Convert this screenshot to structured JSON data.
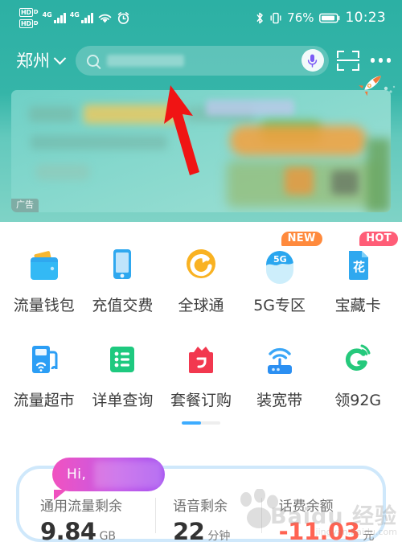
{
  "statusbar": {
    "hd_badges": [
      {
        "box": "HD",
        "sub": "D"
      },
      {
        "box": "HD",
        "sub": "D"
      }
    ],
    "network_labels": [
      "4G",
      "4G"
    ],
    "wifi_icon": "wifi-icon",
    "alarm_icon": "alarm-clock-icon",
    "bluetooth_icon": "bluetooth-icon",
    "vibrate_icon": "vibrate-icon",
    "battery_percent": "76%",
    "battery_icon": "battery-charging-icon",
    "time": "10:23"
  },
  "header": {
    "city": "郑州",
    "city_chevron_icon": "chevron-down-icon",
    "search": {
      "icon": "search-icon",
      "value": "",
      "placeholder": "",
      "mic_icon": "microphone-icon"
    },
    "scan_icon": "scan-qr-icon",
    "more_icon": "more-options-icon"
  },
  "banner": {
    "ad_label": "广告",
    "rocket_icon": "rocket-icon"
  },
  "annotation": {
    "arrow_icon": "red-arrow-up-icon",
    "arrow_color": "#f01414"
  },
  "grid": {
    "rows": [
      [
        {
          "label": "流量钱包",
          "icon": "wallet-icon",
          "badge": null
        },
        {
          "label": "充值交费",
          "icon": "mobile-phone-icon",
          "badge": null
        },
        {
          "label": "全球通",
          "icon": "globe-arrow-icon",
          "badge": null
        },
        {
          "label": "5G专区",
          "icon": "5g-zone-icon",
          "badge": "NEW"
        },
        {
          "label": "宝藏卡",
          "icon": "treasure-card-icon",
          "badge": "HOT"
        }
      ],
      [
        {
          "label": "流量超市",
          "icon": "data-pump-icon",
          "badge": null
        },
        {
          "label": "详单查询",
          "icon": "bill-list-icon",
          "badge": null
        },
        {
          "label": "套餐订购",
          "icon": "package-bag-icon",
          "badge": null
        },
        {
          "label": "装宽带",
          "icon": "router-icon",
          "badge": null
        },
        {
          "label": "领92G",
          "icon": "green-g-signal-icon",
          "badge": null
        }
      ]
    ],
    "pager": {
      "pages": 2,
      "active": 1
    }
  },
  "balance_card": {
    "greeting": "Hi,",
    "stats": [
      {
        "label": "通用流量剩余",
        "value": "9.84",
        "unit": "GB",
        "negative": false
      },
      {
        "label": "语音剩余",
        "value": "22",
        "unit": "分钟",
        "negative": false
      },
      {
        "label": "话费余额",
        "value": "-11.03",
        "unit": "元",
        "negative": true
      }
    ]
  },
  "watermark": {
    "main": "Baidu 经验",
    "sub": "jingyan.baidu.com"
  },
  "colors": {
    "teal": "#35b5a8",
    "badge_new": "#ff8a3d",
    "badge_hot": "#ff5d77",
    "negative": "#ff6352",
    "pager_active": "#3dacff",
    "card_border": "#cfe8fb"
  }
}
